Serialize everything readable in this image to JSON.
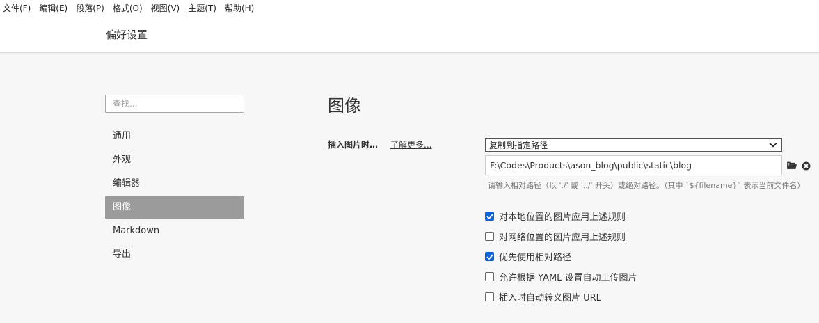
{
  "menubar": {
    "items": [
      "文件(F)",
      "编辑(E)",
      "段落(P)",
      "格式(O)",
      "视图(V)",
      "主题(T)",
      "帮助(H)"
    ]
  },
  "window": {
    "title": "偏好设置"
  },
  "search": {
    "placeholder": "查找..."
  },
  "sidebar": {
    "items": [
      {
        "label": "通用"
      },
      {
        "label": "外观"
      },
      {
        "label": "编辑器"
      },
      {
        "label": "图像",
        "active": true
      },
      {
        "label": "Markdown"
      },
      {
        "label": "导出"
      }
    ]
  },
  "main": {
    "heading": "图像",
    "insert_label": "插入图片时…",
    "learn_more": "了解更多...",
    "insert_option": "复制到指定路径",
    "path_value": "F:\\Codes\\Products\\ason_blog\\public\\static\\blog",
    "hint": "请输入相对路径（以 './' 或 '../' 开头）或绝对路径。（其中 `${filename}` 表示当前文件名）",
    "checkboxes": [
      {
        "label": "对本地位置的图片应用上述规则",
        "checked": true
      },
      {
        "label": "对网络位置的图片应用上述规则",
        "checked": false
      },
      {
        "label": "优先使用相对路径",
        "checked": true
      },
      {
        "label": "允许根据 YAML 设置自动上传图片",
        "checked": false
      },
      {
        "label": "插入时自动转义图片 URL",
        "checked": false
      }
    ]
  },
  "colors": {
    "accent": "#0a64d6",
    "active_nav": "#9b9b9b"
  },
  "icons": {
    "folder": "folder-icon",
    "clear": "clear-icon",
    "dropdown": "chevron-down-icon"
  }
}
